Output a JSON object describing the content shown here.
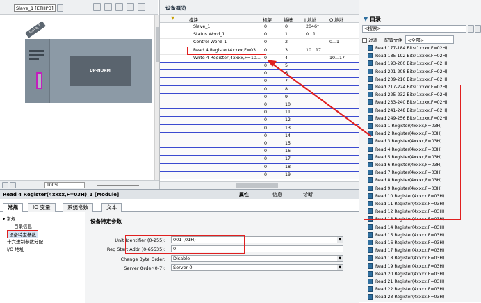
{
  "device_view": {
    "device_selector": "Slave_1 [ETHPB]",
    "zoom": "100%",
    "device_tag": "Slave_1",
    "module_label": "DP-NORM"
  },
  "overview": {
    "tab_label": "设备概览",
    "columns": [
      "模块",
      "机架",
      "插槽",
      "I 地址",
      "Q 地址"
    ],
    "rows": [
      {
        "module": "Slave_1",
        "rack": "0",
        "slot": "0",
        "i": "2046*",
        "q": ""
      },
      {
        "module": "Status Word_1",
        "rack": "0",
        "slot": "1",
        "i": "0...1",
        "q": ""
      },
      {
        "module": "Control Word_1",
        "rack": "0",
        "slot": "2",
        "i": "",
        "q": "0...1"
      },
      {
        "module": "Read 4 Register(4xxxx,F=03...",
        "rack": "0",
        "slot": "3",
        "i": "10...17",
        "q": ""
      },
      {
        "module": "Write 4 Register(4xxxx,F=10...",
        "rack": "0",
        "slot": "4",
        "i": "",
        "q": "10...17"
      },
      {
        "module": "",
        "rack": "0",
        "slot": "5",
        "i": "",
        "q": ""
      },
      {
        "module": "",
        "rack": "0",
        "slot": "6",
        "i": "",
        "q": ""
      },
      {
        "module": "",
        "rack": "0",
        "slot": "7",
        "i": "",
        "q": ""
      },
      {
        "module": "",
        "rack": "0",
        "slot": "8",
        "i": "",
        "q": ""
      },
      {
        "module": "",
        "rack": "0",
        "slot": "9",
        "i": "",
        "q": ""
      },
      {
        "module": "",
        "rack": "0",
        "slot": "10",
        "i": "",
        "q": ""
      },
      {
        "module": "",
        "rack": "0",
        "slot": "11",
        "i": "",
        "q": ""
      },
      {
        "module": "",
        "rack": "0",
        "slot": "12",
        "i": "",
        "q": ""
      },
      {
        "module": "",
        "rack": "0",
        "slot": "13",
        "i": "",
        "q": ""
      },
      {
        "module": "",
        "rack": "0",
        "slot": "14",
        "i": "",
        "q": ""
      },
      {
        "module": "",
        "rack": "0",
        "slot": "15",
        "i": "",
        "q": ""
      },
      {
        "module": "",
        "rack": "0",
        "slot": "16",
        "i": "",
        "q": ""
      },
      {
        "module": "",
        "rack": "0",
        "slot": "17",
        "i": "",
        "q": ""
      },
      {
        "module": "",
        "rack": "0",
        "slot": "18",
        "i": "",
        "q": ""
      },
      {
        "module": "",
        "rack": "0",
        "slot": "19",
        "i": "",
        "q": ""
      }
    ]
  },
  "catalog": {
    "title": "目录",
    "search_placeholder": "<搜索>",
    "filter_label": "过滤",
    "profile_label": "配置文件",
    "profile_value": "<全部>",
    "items": [
      "Read 177-184 Bits(1xxxx,F=02H)",
      "Read 185-192 Bits(1xxxx,F=02H)",
      "Read 193-200 Bits(1xxxx,F=02H)",
      "Read 201-208 Bits(1xxxx,F=02H)",
      "Read 209-216 Bits(1xxxx,F=02H)",
      "Read 217-224 Bits(1xxxx,F=02H)",
      "Read 225-232 Bits(1xxxx,F=02H)",
      "Read 233-240 Bits(1xxxx,F=02H)",
      "Read 241-248 Bits(1xxxx,F=02H)",
      "Read 249-256 Bits(1xxxx,F=02H)",
      "Read 1 Register(4xxxx,F=03H)",
      "Read 2 Register(4xxxx,F=03H)",
      "Read 3 Register(4xxxx,F=03H)",
      "Read 4 Register(4xxxx,F=03H)",
      "Read 5 Register(4xxxx,F=03H)",
      "Read 6 Register(4xxxx,F=03H)",
      "Read 7 Register(4xxxx,F=03H)",
      "Read 8 Register(4xxxx,F=03H)",
      "Read 9 Register(4xxxx,F=03H)",
      "Read 10 Register(4xxxx,F=03H)",
      "Read 11 Register(4xxxx,F=03H)",
      "Read 12 Register(4xxxx,F=03H)",
      "Read 13 Register(4xxxx,F=03H)",
      "Read 14 Register(4xxxx,F=03H)",
      "Read 15 Register(4xxxx,F=03H)",
      "Read 16 Register(4xxxx,F=03H)",
      "Read 17 Register(4xxxx,F=03H)",
      "Read 18 Register(4xxxx,F=03H)",
      "Read 19 Register(4xxxx,F=03H)",
      "Read 20 Register(4xxxx,F=03H)",
      "Read 21 Register(4xxxx,F=03H)",
      "Read 22 Register(4xxxx,F=03H)",
      "Read 23 Register(4xxxx,F=03H)"
    ]
  },
  "properties": {
    "title": "Read 4 Register(4xxxx,F=03H)_1 [Module]",
    "header_tabs": [
      "属性",
      "信息",
      "诊断"
    ],
    "tabs": [
      "常规",
      "IO 变量",
      "系统常数",
      "文本"
    ],
    "nav": [
      "常规",
      "目录信息",
      "设备特定参数",
      "十六进制参数分配",
      "I/O 地址"
    ],
    "section_title": "设备特定参数",
    "fields": [
      {
        "label": "Unit Identifier (0-255):",
        "value": "001 (01H)"
      },
      {
        "label": "Reg Start Addr (0-65535):",
        "value": "0"
      },
      {
        "label": "Change Byte Order:",
        "value": "Disable"
      },
      {
        "label": "Server Order(0-7):",
        "value": "Server 0"
      }
    ]
  },
  "colors": {
    "highlight_red": "#e02020",
    "accent_blue": "#3b4bd0"
  }
}
